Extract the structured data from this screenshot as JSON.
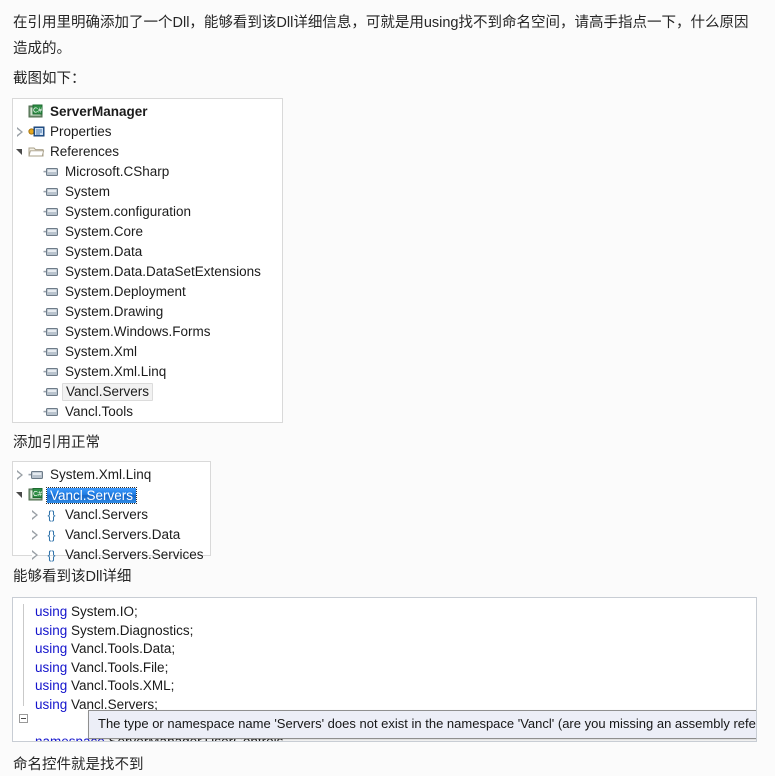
{
  "post": {
    "paragraph": "在引用里明确添加了一个Dll，能够看到该Dll详细信息，可就是用using找不到命名空间，请高手指点一下，什么原因造成的。",
    "screenshot_caption": "截图如下：",
    "caption_after_references_tree": "添加引用正常",
    "caption_after_object_tree": "能够看到该Dll详细",
    "bottom_note": "命名控件就是找不到"
  },
  "references_tree": {
    "name": "solution-explorer-references",
    "rows": [
      {
        "label": "ServerManager",
        "indent": 0,
        "twisty": "none",
        "icon": "csharp-project-icon",
        "bold": true,
        "state": "normal"
      },
      {
        "label": "Properties",
        "indent": 0,
        "twisty": "collapsed",
        "icon": "properties-icon",
        "bold": false,
        "state": "normal"
      },
      {
        "label": "References",
        "indent": 0,
        "twisty": "expanded",
        "icon": "folder-icon",
        "bold": false,
        "state": "normal"
      },
      {
        "label": "Microsoft.CSharp",
        "indent": 1,
        "twisty": "none",
        "icon": "assembly-reference-icon",
        "bold": false,
        "state": "normal"
      },
      {
        "label": "System",
        "indent": 1,
        "twisty": "none",
        "icon": "assembly-reference-icon",
        "bold": false,
        "state": "normal"
      },
      {
        "label": "System.configuration",
        "indent": 1,
        "twisty": "none",
        "icon": "assembly-reference-icon",
        "bold": false,
        "state": "normal"
      },
      {
        "label": "System.Core",
        "indent": 1,
        "twisty": "none",
        "icon": "assembly-reference-icon",
        "bold": false,
        "state": "normal"
      },
      {
        "label": "System.Data",
        "indent": 1,
        "twisty": "none",
        "icon": "assembly-reference-icon",
        "bold": false,
        "state": "normal"
      },
      {
        "label": "System.Data.DataSetExtensions",
        "indent": 1,
        "twisty": "none",
        "icon": "assembly-reference-icon",
        "bold": false,
        "state": "normal"
      },
      {
        "label": "System.Deployment",
        "indent": 1,
        "twisty": "none",
        "icon": "assembly-reference-icon",
        "bold": false,
        "state": "normal"
      },
      {
        "label": "System.Drawing",
        "indent": 1,
        "twisty": "none",
        "icon": "assembly-reference-icon",
        "bold": false,
        "state": "normal"
      },
      {
        "label": "System.Windows.Forms",
        "indent": 1,
        "twisty": "none",
        "icon": "assembly-reference-icon",
        "bold": false,
        "state": "normal"
      },
      {
        "label": "System.Xml",
        "indent": 1,
        "twisty": "none",
        "icon": "assembly-reference-icon",
        "bold": false,
        "state": "normal"
      },
      {
        "label": "System.Xml.Linq",
        "indent": 1,
        "twisty": "none",
        "icon": "assembly-reference-icon",
        "bold": false,
        "state": "normal"
      },
      {
        "label": "Vancl.Servers",
        "indent": 1,
        "twisty": "none",
        "icon": "assembly-reference-icon",
        "bold": false,
        "state": "hover"
      },
      {
        "label": "Vancl.Tools",
        "indent": 1,
        "twisty": "none",
        "icon": "assembly-reference-icon",
        "bold": false,
        "state": "normal"
      }
    ]
  },
  "object_browser_tree": {
    "name": "object-browser",
    "rows": [
      {
        "label": "System.Xml.Linq",
        "indent": 0,
        "twisty": "collapsed",
        "icon": "assembly-reference-icon",
        "bold": false,
        "state": "normal"
      },
      {
        "label": "Vancl.Servers",
        "indent": 0,
        "twisty": "expanded",
        "icon": "csharp-assembly-icon",
        "bold": false,
        "state": "selected"
      },
      {
        "label": "Vancl.Servers",
        "indent": 1,
        "twisty": "collapsed",
        "icon": "namespace-icon",
        "bold": false,
        "state": "normal"
      },
      {
        "label": "Vancl.Servers.Data",
        "indent": 1,
        "twisty": "collapsed",
        "icon": "namespace-icon",
        "bold": false,
        "state": "normal"
      },
      {
        "label": "Vancl.Servers.Services",
        "indent": 1,
        "twisty": "collapsed",
        "icon": "namespace-icon",
        "bold": false,
        "state": "normal"
      }
    ]
  },
  "code_editor": {
    "name": "visual-studio-code-editor",
    "lines": [
      {
        "keyword": "using",
        "rest": " System.IO;",
        "error_span": ""
      },
      {
        "keyword": "using",
        "rest": " System.Diagnostics;",
        "error_span": ""
      },
      {
        "keyword": "using",
        "rest": " Vancl.Tools.Data;",
        "error_span": ""
      },
      {
        "keyword": "using",
        "rest": " Vancl.Tools.File;",
        "error_span": ""
      },
      {
        "keyword": "using",
        "rest": " Vancl.Tools.XML;",
        "error_span": ""
      },
      {
        "keyword": "using",
        "rest": " Vancl.",
        "error_span": "Servers",
        "tail": ";"
      },
      {
        "keyword": "",
        "rest": "",
        "error_span": ""
      },
      {
        "keyword": "namespace",
        "rest": " ServerManager.UserControls",
        "error_span": ""
      }
    ],
    "error_tooltip": "The type or namespace name 'Servers' does not exist in the namespace 'Vancl' (are you missing an assembly reference?)"
  },
  "colors": {
    "keyword_blue": "#1414cc",
    "selection_blue": "#1e7ae0",
    "error_red": "#e03030",
    "tooltip_background": "#eceef7",
    "panel_border": "#d9d9d9",
    "page_background": "#fbfbfb"
  }
}
